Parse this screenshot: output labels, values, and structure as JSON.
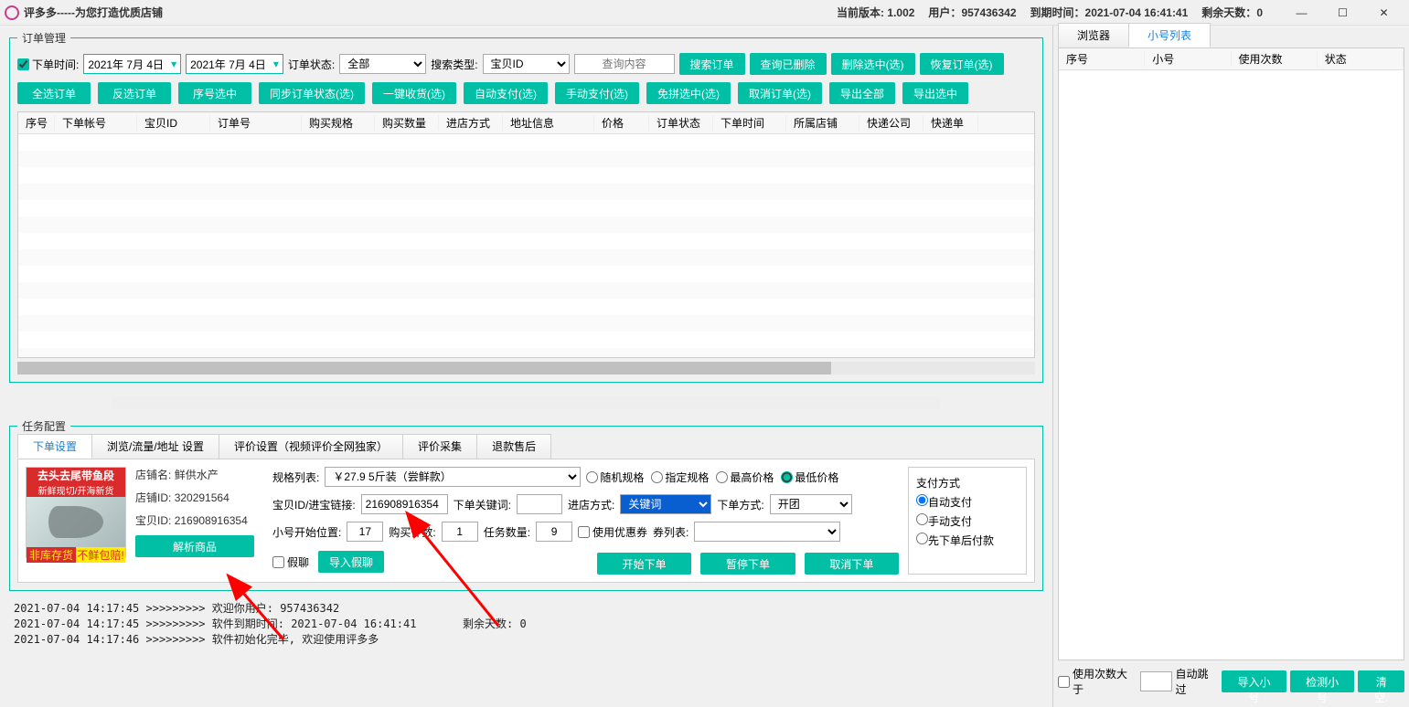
{
  "titlebar": {
    "title": "评多多-----为您打造优质店铺",
    "version_label": "当前版本:",
    "version": "1.002",
    "user_label": "用户：",
    "user": "957436342",
    "expire_label": "到期时间：",
    "expire": "2021-07-04 16:41:41",
    "remaining_label": "剩余天数：",
    "remaining": "0"
  },
  "order_mgmt": {
    "legend": "订单管理",
    "order_time_label": "下单时间:",
    "date_from": "2021年 7月 4日",
    "date_to": "2021年 7月 4日",
    "status_label": "订单状态:",
    "status_value": "全部",
    "search_type_label": "搜索类型:",
    "search_type_value": "宝贝ID",
    "search_placeholder": "查询内容",
    "btn_search": "搜索订单",
    "btn_query_deleted": "查询已删除",
    "btn_delete_selected": "删除选中(选)",
    "btn_restore": "恢复订单(选)",
    "buttons": {
      "select_all": "全选订单",
      "invert": "反选订单",
      "seq_select": "序号选中",
      "sync_status": "同步订单状态(选)",
      "one_key_receive": "一键收货(选)",
      "auto_pay": "自动支付(选)",
      "manual_pay": "手动支付(选)",
      "free_group": "免拼选中(选)",
      "cancel_order": "取消订单(选)",
      "export_all": "导出全部",
      "export_selected": "导出选中"
    },
    "columns": [
      "序号",
      "下单帐号",
      "宝贝ID",
      "订单号",
      "购买规格",
      "购买数量",
      "进店方式",
      "地址信息",
      "价格",
      "订单状态",
      "下单时间",
      "所属店铺",
      "快递公司",
      "快递单"
    ]
  },
  "task_config": {
    "legend": "任务配置",
    "tabs": [
      "下单设置",
      "浏览/流量/地址 设置",
      "评价设置（视频评价全网独家）",
      "评价采集",
      "退款售后"
    ],
    "product": {
      "title": "去头去尾带鱼段",
      "subtitle": "新鲜现切/开海新货",
      "tag1": "非库存货",
      "tag2": "不鲜包赔!"
    },
    "shop": {
      "name_label": "店铺名:",
      "name": "鲜供水产",
      "id_label": "店铺ID:",
      "id": "320291564",
      "item_id_label": "宝贝ID:",
      "item_id": "216908916354",
      "parse_btn": "解析商品"
    },
    "spec": {
      "spec_list_label": "规格列表:",
      "spec_value": "￥27.9  5斤装（尝鲜款）",
      "random_spec": "随机规格",
      "specified_spec": "指定规格",
      "highest_price": "最高价格",
      "lowest_price": "最低价格"
    },
    "item": {
      "item_link_label": "宝贝ID/进宝链接:",
      "item_link_value": "216908916354",
      "keyword_label": "下单关键词:",
      "enter_method_label": "进店方式:",
      "enter_method_value": "关键词",
      "order_method_label": "下单方式:",
      "order_method_value": "开团"
    },
    "nums": {
      "start_pos_label": "小号开始位置:",
      "start_pos": "17",
      "buy_qty_label": "购买件数:",
      "buy_qty": "1",
      "task_qty_label": "任务数量:",
      "task_qty": "9",
      "use_coupon": "使用优惠券",
      "coupon_list_label": "券列表:"
    },
    "chat": {
      "fake_chat": "假聊",
      "import_fake_chat": "导入假聊"
    },
    "actions": {
      "start": "开始下单",
      "pause": "暂停下单",
      "cancel": "取消下单"
    },
    "pay": {
      "title": "支付方式",
      "auto": "自动支付",
      "manual": "手动支付",
      "order_first": "先下单后付款"
    }
  },
  "logs": [
    "2021-07-04 14:17:45 >>>>>>>>> 欢迎你用户: 957436342",
    "2021-07-04 14:17:45 >>>>>>>>> 软件到期时间: 2021-07-04 16:41:41       剩余天数: 0",
    "2021-07-04 14:17:46 >>>>>>>>> 软件初始化完毕, 欢迎使用评多多"
  ],
  "right": {
    "tabs": [
      "浏览器",
      "小号列表"
    ],
    "columns": [
      "序号",
      "小号",
      "使用次数",
      "状态"
    ],
    "use_count_gt": "使用次数大于",
    "auto_skip": "自动跳过",
    "import": "导入小号",
    "detect": "检测小号",
    "clear": "清空."
  }
}
